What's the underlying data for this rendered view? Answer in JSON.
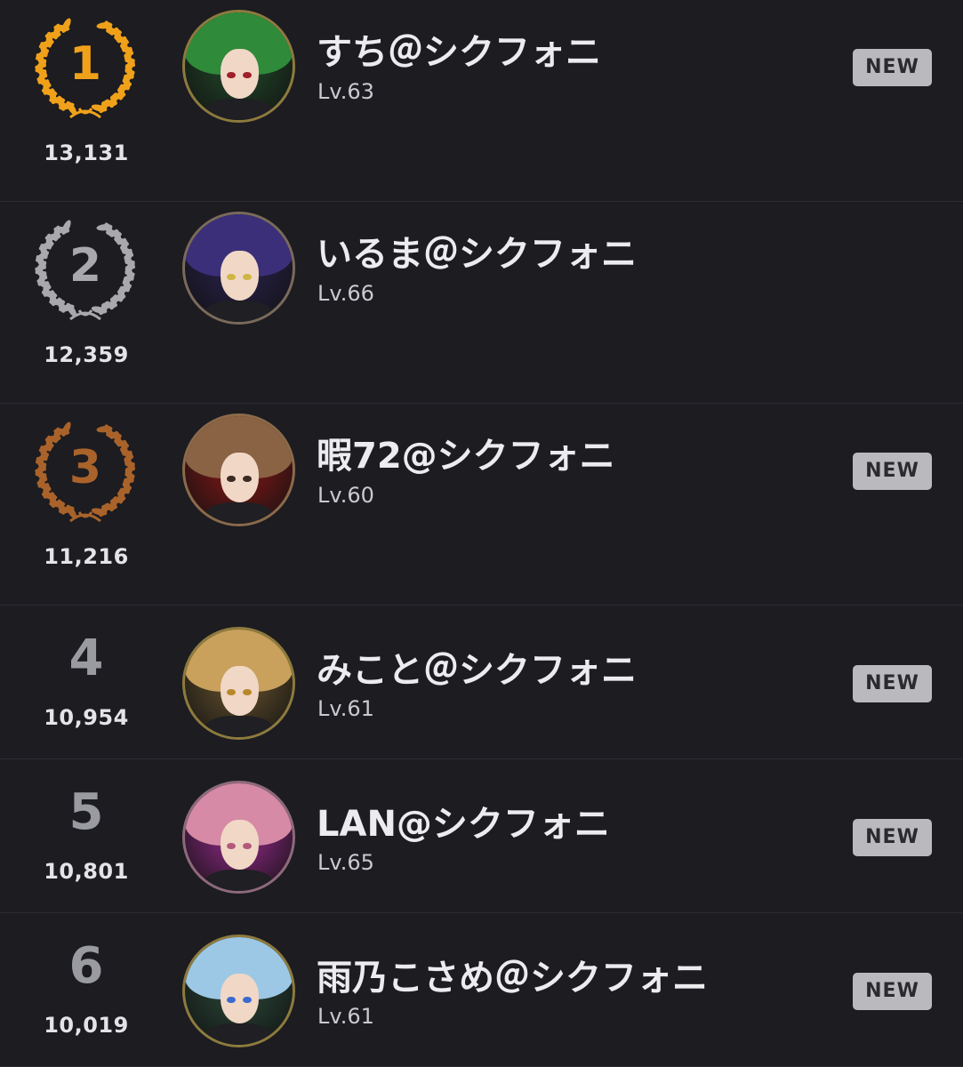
{
  "colors": {
    "gold": "#f0a11a",
    "silver": "#a8a8ad",
    "bronze": "#a9632a",
    "plain_rank": "#9a9aa1",
    "badge_bg": "#b9b9be"
  },
  "entries": [
    {
      "rank": "1",
      "score": "13,131",
      "name": "すち＠シクフォニ",
      "level": "Lv.63",
      "badge": "NEW",
      "medal": "gold",
      "avatar_colors": {
        "hair": "#2f8a3a",
        "bg": "#234a2a",
        "eye": "#a01f2c",
        "border": "#8d7a3e"
      }
    },
    {
      "rank": "2",
      "score": "12,359",
      "name": "いるま＠シクフォニ",
      "level": "Lv.66",
      "badge": "",
      "medal": "silver",
      "avatar_colors": {
        "hair": "#3b2f7a",
        "bg": "#2a2350",
        "eye": "#d0b544",
        "border": "#7a6a5a"
      }
    },
    {
      "rank": "3",
      "score": "11,216",
      "name": "暇72@シクフォニ",
      "level": "Lv.60",
      "badge": "NEW",
      "medal": "bronze",
      "avatar_colors": {
        "hair": "#8a6244",
        "bg": "#8a1717",
        "eye": "#3a2a22",
        "border": "#8a6a4a"
      }
    },
    {
      "rank": "4",
      "score": "10,954",
      "name": "みこと＠シクフォニ",
      "level": "Lv.61",
      "badge": "NEW",
      "medal": "",
      "avatar_colors": {
        "hair": "#c9a15c",
        "bg": "#6a5530",
        "eye": "#b8872a",
        "border": "#8d7a3e"
      }
    },
    {
      "rank": "5",
      "score": "10,801",
      "name": "LAN@シクフォニ",
      "level": "Lv.65",
      "badge": "NEW",
      "medal": "",
      "avatar_colors": {
        "hair": "#d68aa5",
        "bg": "#9a2b8f",
        "eye": "#b35a7a",
        "border": "#8d6a7a"
      }
    },
    {
      "rank": "6",
      "score": "10,019",
      "name": "雨乃こさめ＠シクフォニ",
      "level": "Lv.61",
      "badge": "NEW",
      "medal": "",
      "avatar_colors": {
        "hair": "#9cc8e6",
        "bg": "#2b4a3a",
        "eye": "#3a6ad0",
        "border": "#8d7a3e"
      }
    }
  ]
}
